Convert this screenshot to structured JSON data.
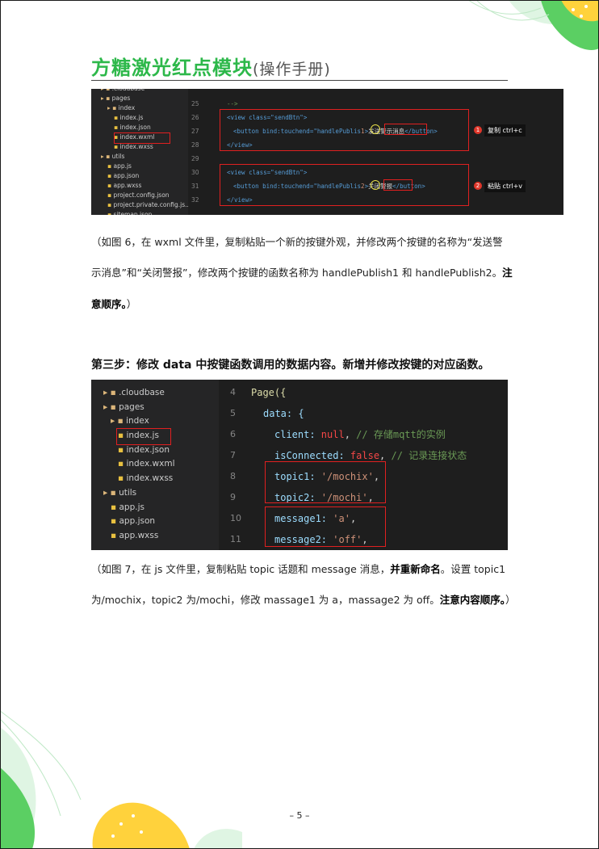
{
  "header": {
    "title": "方糖激光红点模块",
    "subtitle": "(操作手册)"
  },
  "figure6": {
    "tree": [
      {
        "label": ".cloudbase",
        "indent": 1
      },
      {
        "label": "pages",
        "indent": 1
      },
      {
        "label": "index",
        "indent": 2
      },
      {
        "label": "index.js",
        "indent": 3
      },
      {
        "label": "index.json",
        "indent": 3
      },
      {
        "label": "index.wxml",
        "indent": 3
      },
      {
        "label": "index.wxss",
        "indent": 3
      },
      {
        "label": "utils",
        "indent": 1
      },
      {
        "label": "app.js",
        "indent": 2
      },
      {
        "label": "app.json",
        "indent": 2
      },
      {
        "label": "app.wxss",
        "indent": 2
      },
      {
        "label": "project.config.json",
        "indent": 2
      },
      {
        "label": "project.private.config.js...",
        "indent": 2
      },
      {
        "label": "sitemap.json",
        "indent": 2
      }
    ],
    "line_numbers": [
      "25",
      "26",
      "27",
      "28",
      "29",
      "30",
      "31",
      "32"
    ],
    "code": {
      "c25": "-->",
      "c26_open": "<view class=\"sendBtn\">",
      "c27_pre": "<button bind:touchend=\"handlePublis",
      "c27_num": "1",
      "c27_mid": ">",
      "c27_label": "发送警示消息",
      "c27_post": "</button>",
      "c28": "</view>",
      "c30_open": "<view class=\"sendBtn\">",
      "c31_pre": "<button bind:touchend=\"handlePublis",
      "c31_num": "2",
      "c31_mid": ">",
      "c31_label": "关闭警报",
      "c31_post": "</button>",
      "c32": "</view>"
    },
    "notes": [
      {
        "badge": "1",
        "text": "复制 ctrl+c"
      },
      {
        "badge": "2",
        "text": "粘贴 ctrl+v"
      }
    ]
  },
  "paragraph1": {
    "line1": "（如图 6，在 wxml 文件里，复制粘贴一个新的按键外观，并修改两个按键的名称为“发送警",
    "line2_plain": "示消息”和“关闭警报”，修改两个按键的函数名称为 handlePublish1 和 handlePublish2。",
    "line2_bold": "注",
    "line3_bold": "意顺序。",
    "line3_plain": "）"
  },
  "step3": {
    "heading": "第三步：修改 data 中按键函数调用的数据内容。新增并修改按键的对应函数。"
  },
  "figure7": {
    "tree": [
      {
        "label": ".cloudbase",
        "indent": 1
      },
      {
        "label": "pages",
        "indent": 1
      },
      {
        "label": "index",
        "indent": 2
      },
      {
        "label": "index.js",
        "indent": 3
      },
      {
        "label": "index.json",
        "indent": 3
      },
      {
        "label": "index.wxml",
        "indent": 3
      },
      {
        "label": "index.wxss",
        "indent": 3
      },
      {
        "label": "utils",
        "indent": 1
      },
      {
        "label": "app.js",
        "indent": 2
      },
      {
        "label": "app.json",
        "indent": 2
      },
      {
        "label": "app.wxss",
        "indent": 2
      }
    ],
    "line_numbers": [
      "4",
      "5",
      "6",
      "7",
      "8",
      "9",
      "10",
      "11"
    ],
    "code": {
      "l4": "Page({",
      "l5": "data: {",
      "l6_key": "client: ",
      "l6_val": "null",
      "l6_cm": "// 存储mqtt的实例",
      "l7_key": "isConnected: ",
      "l7_val": "false",
      "l7_cm": "// 记录连接状态",
      "l8_key": "topic1: ",
      "l8_val": "'/mochix'",
      "l9_key": "topic2: ",
      "l9_val": "'/mochi'",
      "l10_key": "message1: ",
      "l10_val": "'a'",
      "l11_key": "message2: ",
      "l11_val": "'off'",
      "comma": ","
    }
  },
  "paragraph2": {
    "line1_plain": "（如图 7，在 js 文件里，复制粘贴 topic 话题和 message 消息，",
    "line1_bold": "并重新命名",
    "line1_tail": "。设置 topic1",
    "line2_plain": "为/mochix，topic2 为/mochi，修改 massage1 为  a，massage2 为 off。",
    "line2_bold": "注意内容顺序。",
    "line2_tail": "）"
  },
  "footer": {
    "page_number": "– 5 –"
  },
  "colors": {
    "accent": "#2db84a",
    "highlight": "#e02020",
    "editor_bg": "#1e1e1e"
  }
}
